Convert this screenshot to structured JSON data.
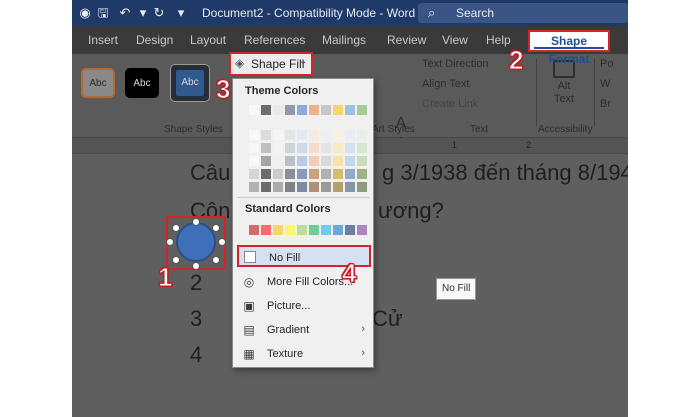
{
  "titlebar": {
    "autosave_icon": "toggle-icon",
    "save_icon": "save-icon",
    "undo_icon": "undo-icon",
    "redo_icon": "redo-icon",
    "document_title": "Document2  -  Compatibility Mode  -  Word",
    "search_placeholder": "Search"
  },
  "tabs": [
    "Insert",
    "Design",
    "Layout",
    "References",
    "Mailings",
    "Review",
    "View",
    "Help"
  ],
  "active_tab": "Shape Format",
  "ribbon": {
    "shape_styles": [
      "Abc",
      "Abc",
      "Abc"
    ],
    "shape_styles_label": "Shape Styles",
    "shape_fill_label": "Shape Fill",
    "wordart_group_label": "Art Styles",
    "text_direction_label": "Text Direction",
    "align_text_label": "Align Text",
    "create_link_label": "Create Link",
    "text_group_label": "Text",
    "alt_text_label_1": "Alt",
    "alt_text_label_2": "Text",
    "accessibility_label": "Accessibility",
    "side_cmds": [
      "Po",
      "W",
      "Br"
    ]
  },
  "ruler_numbers": [
    "1",
    "2"
  ],
  "document": {
    "lines": [
      "Câu",
      "g 3/1938 đến tháng 8/194",
      "Côn",
      "ương?",
      "2",
      "3",
      "Cử",
      "4"
    ]
  },
  "dropdown": {
    "theme_colors_heading": "Theme Colors",
    "standard_colors_heading": "Standard Colors",
    "no_fill_label": "No Fill",
    "more_fill_colors_label": "More Fill Colors...",
    "picture_label": "Picture...",
    "gradient_label": "Gradient",
    "texture_label": "Texture",
    "theme_base_colors": [
      "#ffffff",
      "#000000",
      "#e7e6e6",
      "#44546a",
      "#4472c4",
      "#ed7d31",
      "#a5a5a5",
      "#ffc000",
      "#5b9bd5",
      "#70ad47"
    ],
    "standard_colors": [
      "#c00000",
      "#ff0000",
      "#ffc000",
      "#ffff00",
      "#92d050",
      "#00b050",
      "#00b0f0",
      "#0070c0",
      "#002060",
      "#7030a0"
    ]
  },
  "tooltip": "No Fill",
  "steps": [
    "1",
    "2",
    "3",
    "4"
  ],
  "colors": {
    "annotation_red": "#d8222a",
    "accent_blue": "#1e4e9a",
    "shape_fill": "#3f6fb8"
  }
}
